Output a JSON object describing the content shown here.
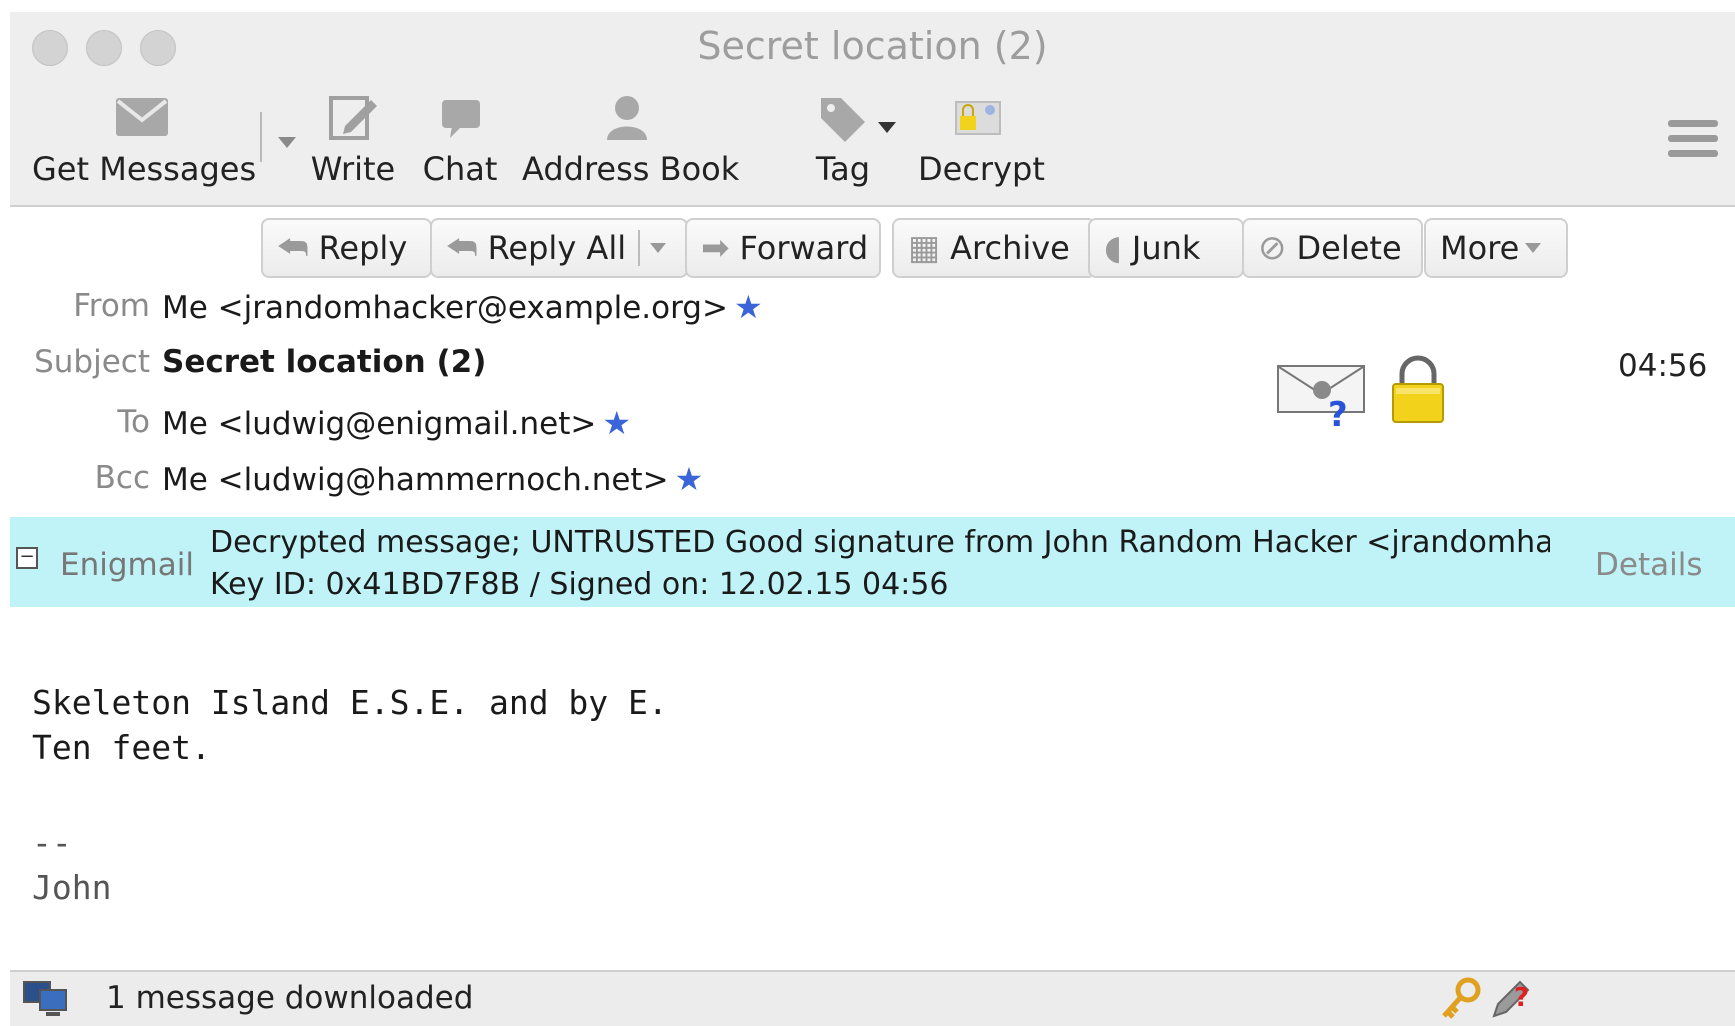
{
  "window": {
    "title": "Secret location (2)"
  },
  "toolbar": {
    "get_messages": "Get Messages",
    "write": "Write",
    "chat": "Chat",
    "address_book": "Address Book",
    "tag": "Tag",
    "decrypt": "Decrypt"
  },
  "actions": {
    "reply": "Reply",
    "reply_all": "Reply All",
    "forward": "Forward",
    "archive": "Archive",
    "junk": "Junk",
    "delete": "Delete",
    "more": "More"
  },
  "header": {
    "from_label": "From",
    "from_value": "Me <jrandomhacker@example.org>",
    "subject_label": "Subject",
    "subject_value": "Secret location (2)",
    "to_label": "To",
    "to_value": "Me <ludwig@enigmail.net>",
    "bcc_label": "Bcc",
    "bcc_value": "Me <ludwig@hammernoch.net>",
    "time": "04:56"
  },
  "enigmail": {
    "toggle": "−",
    "label": "Enigmail",
    "line1": "Decrypted message; UNTRUSTED Good signature from John Random Hacker <jrandomhacker@example.org>",
    "line2": "Key ID: 0x41BD7F8B / Signed on: 12.02.15 04:56",
    "details": "Details"
  },
  "message": {
    "line1": "Skeleton Island E.S.E. and by E.",
    "line2": "Ten feet.",
    "sig_sep": "--",
    "sig_name": "John"
  },
  "status": {
    "text": "1 message downloaded"
  },
  "colors": {
    "enigmail_bar": "#bff3f7",
    "star": "#3a64d8",
    "lock": "#f2d21a"
  }
}
